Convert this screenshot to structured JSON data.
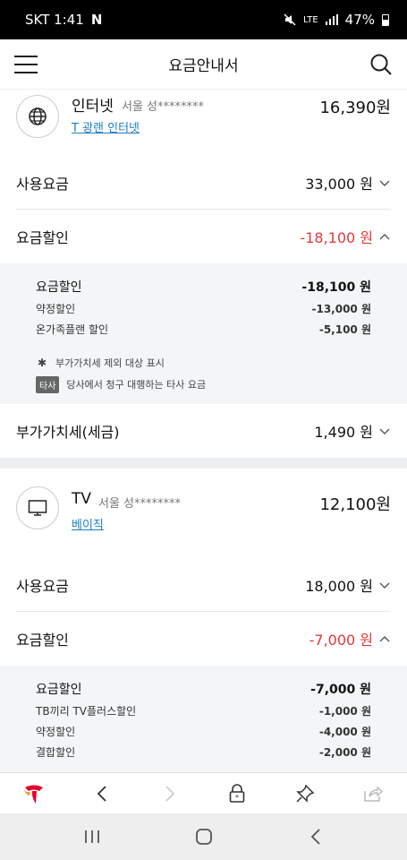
{
  "status_bar": {
    "carrier_time": "SKT 1:41",
    "n_icon": "N",
    "lte": "LTE",
    "battery": "47%"
  },
  "header": {
    "title": "요금안내서"
  },
  "internet": {
    "name": "인터넷",
    "address": "서울 성********",
    "plan": "T 광랜 인터넷",
    "total": "16,390원",
    "usage": {
      "label": "사용요금",
      "value": "33,000 원"
    },
    "discount": {
      "label": "요금할인",
      "value": "-18,100 원"
    },
    "detail": {
      "head_label": "요금할인",
      "head_amount": "-18,100 원",
      "items": [
        {
          "label": "약정할인",
          "amount": "-13,000 원"
        },
        {
          "label": "온가족플랜 할인",
          "amount": "-5,100 원"
        }
      ],
      "note_star": "부가가치세 제외 대상 표시",
      "note_badge": "타사",
      "note_other": "당사에서 청구 대행하는 타사 요금"
    },
    "vat": {
      "label": "부가가치세(세금)",
      "value": "1,490 원"
    }
  },
  "tv": {
    "name": "TV",
    "address": "서울 성********",
    "plan": "베이직",
    "total": "12,100원",
    "usage": {
      "label": "사용요금",
      "value": "18,000 원"
    },
    "discount": {
      "label": "요금할인",
      "value": "-7,000 원"
    },
    "detail": {
      "head_label": "요금할인",
      "head_amount": "-7,000 원",
      "items": [
        {
          "label": "TB끼리 TV플러스할인",
          "amount": "-1,000 원"
        },
        {
          "label": "약정할인",
          "amount": "-4,000 원"
        },
        {
          "label": "결합할인",
          "amount": "-2,000 원"
        }
      ]
    }
  },
  "colors": {
    "accent_red": "#e03a3a",
    "link_blue": "#1a7fc1",
    "brand_red": "#e4002b"
  }
}
